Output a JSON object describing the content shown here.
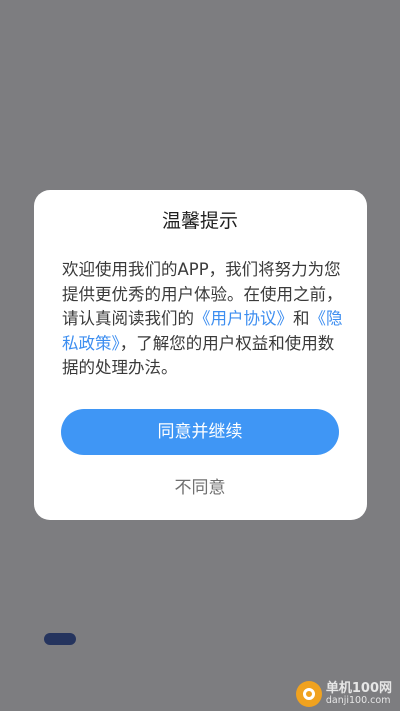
{
  "dialog": {
    "title": "温馨提示",
    "message_prefix": "欢迎使用我们的APP，我们将努力为您提供更优秀的用户体验。在使用之前，请认真阅读我们的",
    "user_agreement_link": "《用户协议》",
    "message_and": "和",
    "privacy_policy_link": "《隐私政策》",
    "message_suffix": "，了解您的用户权益和使用数据的处理办法。",
    "agree_label": "同意并继续",
    "disagree_label": "不同意"
  },
  "watermark": {
    "name": "单机100网",
    "url": "danji100.com"
  },
  "colors": {
    "overlay": "#7d7d80",
    "link": "#3d8ef0",
    "primary_button": "#3f96f5",
    "watermark_logo": "#f0a21f"
  }
}
